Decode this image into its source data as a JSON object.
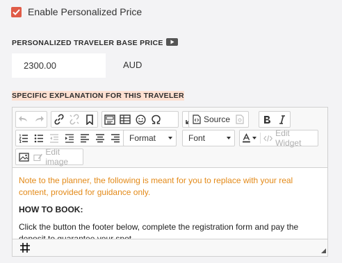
{
  "personalized": {
    "checkbox_label": "Enable Personalized Price",
    "checked": true,
    "accent_color": "#e05b47"
  },
  "base_price": {
    "title": "PERSONALIZED TRAVELER BASE PRICE",
    "value": "2300.00",
    "currency": "AUD"
  },
  "explanation": {
    "title": "SPECIFIC EXPLANATION FOR THIS TRAVELER",
    "highlight_color": "#fde0d1"
  },
  "editor": {
    "toolbar": {
      "source_label": "Source",
      "format_label": "Format",
      "font_label": "Font",
      "edit_widget_label": "Edit Widget",
      "edit_image_label": "Edit image"
    },
    "content": {
      "note": "Note to the planner, the following is meant for you to replace with your real content, provided for guidance only.",
      "heading": "HOW TO BOOK:",
      "body": "Click the button the footer below, complete the registration form and pay the deposit to guarantee your spot."
    }
  }
}
